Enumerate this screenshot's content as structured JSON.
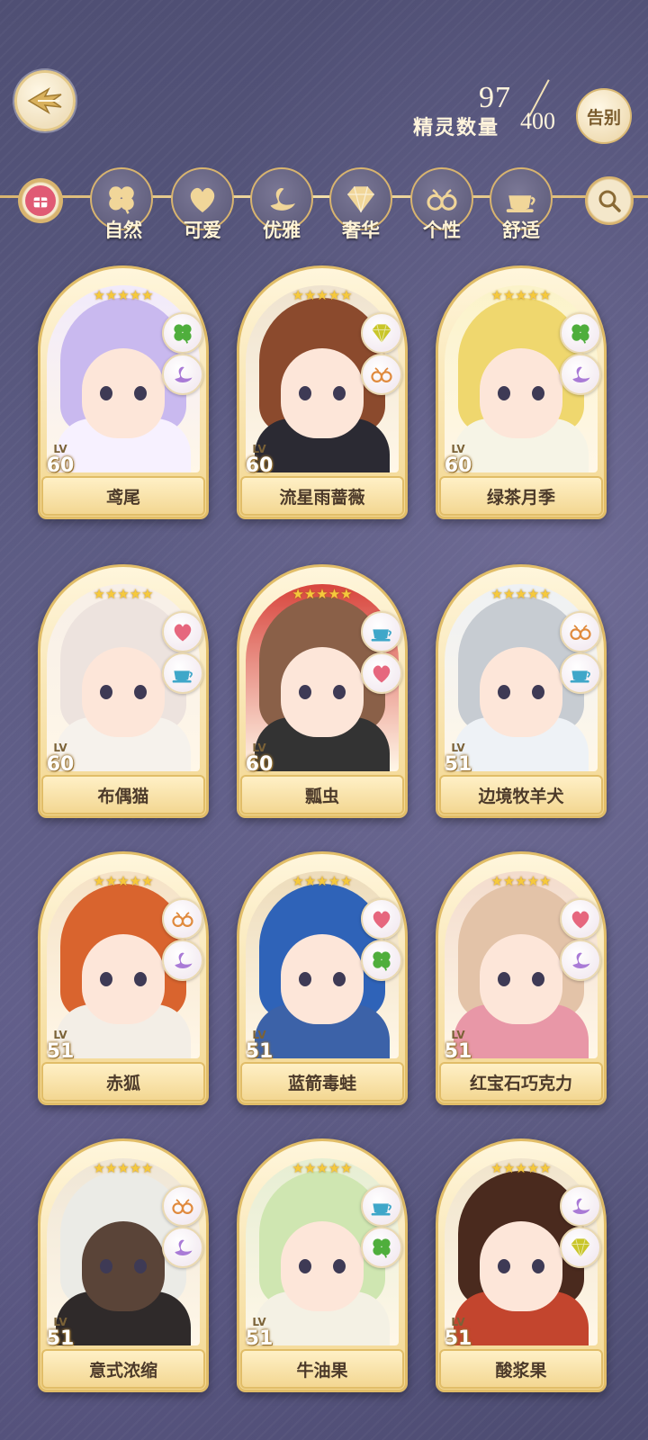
{
  "header": {
    "count_value": "97",
    "count_total": "400",
    "count_label": "精灵数量",
    "farewell_label": "告别"
  },
  "filters": [
    {
      "label": "自然",
      "icon": "clover-icon"
    },
    {
      "label": "可爱",
      "icon": "heart-icon"
    },
    {
      "label": "优雅",
      "icon": "swan-icon"
    },
    {
      "label": "奢华",
      "icon": "diamond-icon"
    },
    {
      "label": "个性",
      "icon": "glasses-icon"
    },
    {
      "label": "舒适",
      "icon": "teacup-icon"
    }
  ],
  "cards": [
    {
      "name": "鸢尾",
      "level": "60",
      "stars": "★★★★★",
      "tags": [
        "clover",
        "swan"
      ]
    },
    {
      "name": "流星雨蔷薇",
      "level": "60",
      "stars": "★★★★★",
      "tags": [
        "diamond",
        "glasses"
      ]
    },
    {
      "name": "绿茶月季",
      "level": "60",
      "stars": "★★★★★",
      "tags": [
        "clover",
        "swan"
      ]
    },
    {
      "name": "布偶猫",
      "level": "60",
      "stars": "★★★★★",
      "tags": [
        "heart",
        "teacup"
      ]
    },
    {
      "name": "瓢虫",
      "level": "60",
      "stars": "★★★★★",
      "tags": [
        "teacup",
        "heart"
      ]
    },
    {
      "name": "边境牧羊犬",
      "level": "51",
      "stars": "★★★★★",
      "tags": [
        "glasses",
        "teacup"
      ]
    },
    {
      "name": "赤狐",
      "level": "51",
      "stars": "★★★★★",
      "tags": [
        "glasses",
        "swan"
      ]
    },
    {
      "name": "蓝箭毒蛙",
      "level": "51",
      "stars": "★★★★★",
      "tags": [
        "heart",
        "clover"
      ]
    },
    {
      "name": "红宝石巧克力",
      "level": "51",
      "stars": "★★★★★",
      "tags": [
        "heart",
        "swan"
      ]
    },
    {
      "name": "意式浓缩",
      "level": "51",
      "stars": "★★★★★",
      "tags": [
        "glasses",
        "swan"
      ]
    },
    {
      "name": "牛油果",
      "level": "51",
      "stars": "★★★★★",
      "tags": [
        "teacup",
        "clover"
      ]
    },
    {
      "name": "酸浆果",
      "level": "51",
      "stars": "★★★★★",
      "tags": [
        "swan",
        "diamond"
      ]
    }
  ],
  "lv_label": "LV",
  "colors": {
    "accent_gold": "#e1bd68",
    "clover": "#4fae3c",
    "heart": "#e6677e",
    "swan": "#a97ad6",
    "diamond": "#c9c62a",
    "glasses": "#e08a3d",
    "teacup": "#3fa7c9"
  }
}
